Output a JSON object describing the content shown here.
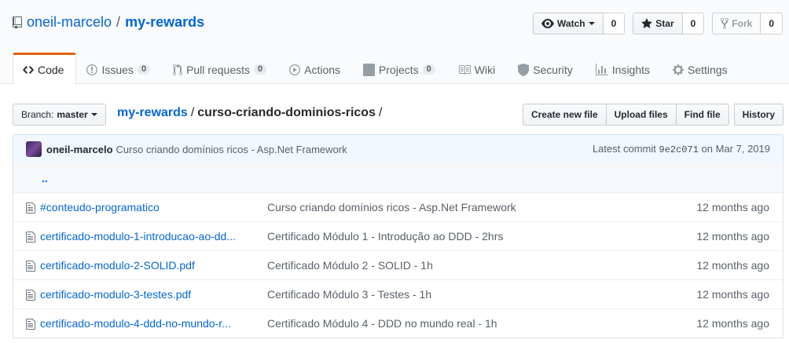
{
  "repo": {
    "owner": "oneil-marcelo",
    "separator": "/",
    "name": "my-rewards"
  },
  "actions": {
    "watch": {
      "label": "Watch",
      "count": "0"
    },
    "star": {
      "label": "Star",
      "count": "0"
    },
    "fork": {
      "label": "Fork",
      "count": "0"
    }
  },
  "nav": {
    "code": "Code",
    "issues": {
      "label": "Issues",
      "count": "0"
    },
    "pulls": {
      "label": "Pull requests",
      "count": "0"
    },
    "actions": "Actions",
    "projects": {
      "label": "Projects",
      "count": "0"
    },
    "wiki": "Wiki",
    "security": "Security",
    "insights": "Insights",
    "settings": "Settings"
  },
  "file_nav": {
    "branch_prefix": "Branch:",
    "branch": "master",
    "breadcrumb_root": "my-rewards",
    "breadcrumb_dir": "curso-criando-dominios-ricos",
    "slash": "/",
    "create_new": "Create new file",
    "upload": "Upload files",
    "find": "Find file",
    "history": "History"
  },
  "commit": {
    "author": "oneil-marcelo",
    "message": "Curso criando domínios ricos - Asp.Net Framework",
    "latest_label": "Latest commit",
    "sha": "9e2c071",
    "date": "on Mar 7, 2019"
  },
  "up_link": "..",
  "files": [
    {
      "name": "#conteudo-programatico",
      "message": "Curso criando domínios ricos - Asp.Net Framework",
      "age": "12 months ago"
    },
    {
      "name": "certificado-modulo-1-introducao-ao-dd...",
      "message": "Certificado Módulo 1 - Introdução ao DDD - 2hrs",
      "age": "12 months ago"
    },
    {
      "name": "certificado-modulo-2-SOLID.pdf",
      "message": "Certificado Módulo 2 - SOLID - 1h",
      "age": "12 months ago"
    },
    {
      "name": "certificado-modulo-3-testes.pdf",
      "message": "Certificado Módulo 3 - Testes - 1h",
      "age": "12 months ago"
    },
    {
      "name": "certificado-modulo-4-ddd-no-mundo-r...",
      "message": "Certificado Módulo 4 - DDD no mundo real - 1h",
      "age": "12 months ago"
    }
  ]
}
